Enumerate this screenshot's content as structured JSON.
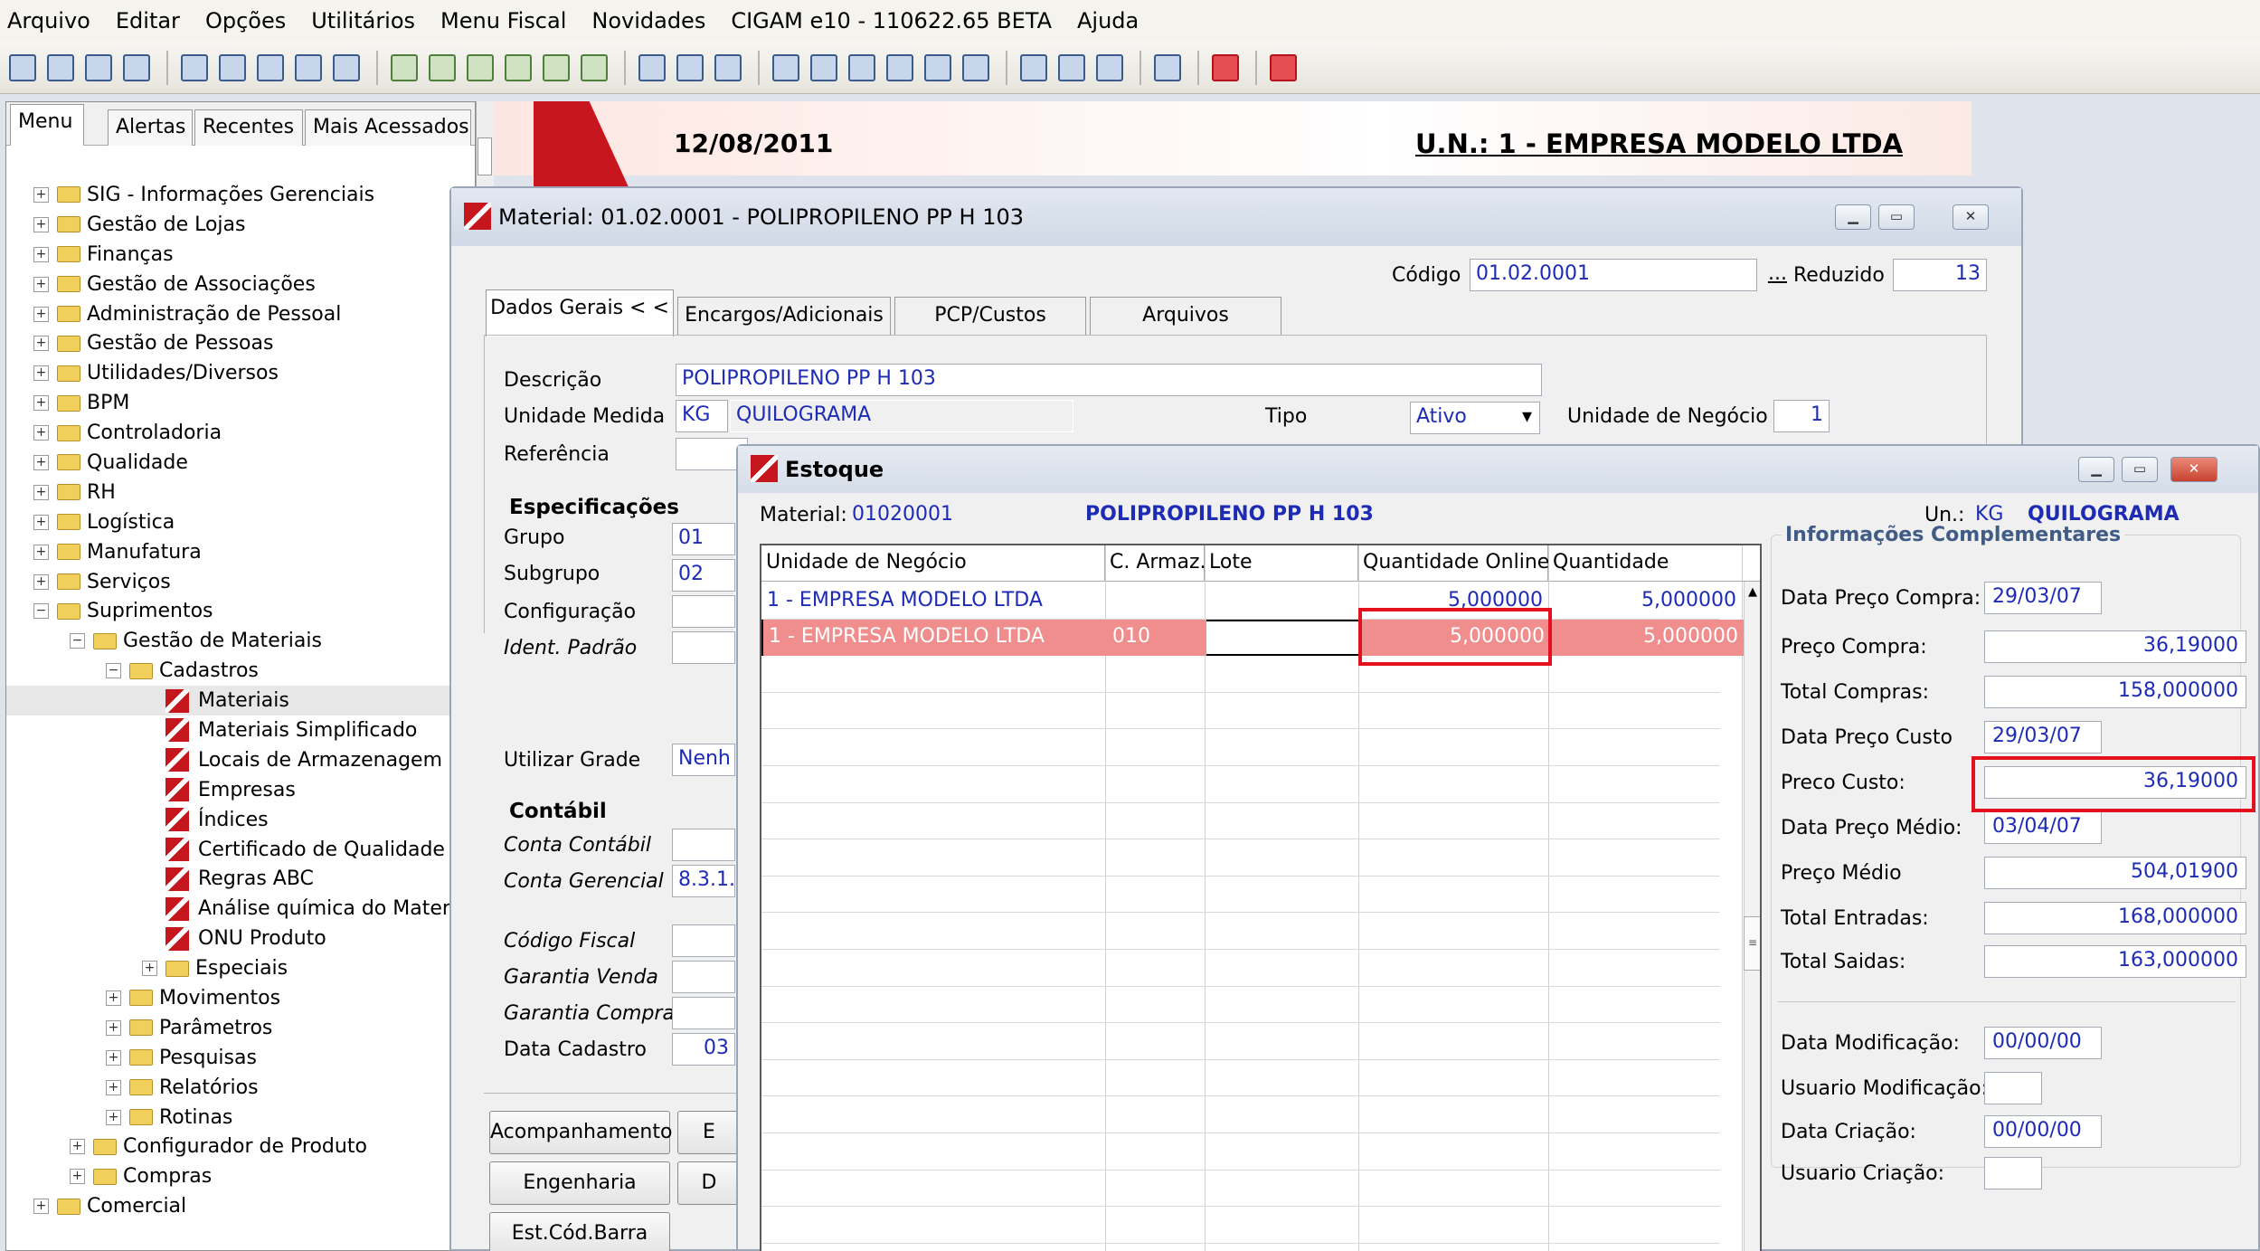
{
  "menubar": {
    "items": [
      "Arquivo",
      "Editar",
      "Opções",
      "Utilitários",
      "Menu Fiscal",
      "Novidades",
      "CIGAM e10 - 110622.65 BETA",
      "Ajuda"
    ]
  },
  "left_panel": {
    "tabs": [
      "Menu",
      "Alertas",
      "Recentes",
      "Mais Acessados"
    ],
    "tree": [
      {
        "label": "SIG - Informações Gerenciais",
        "level": 0,
        "expander": "+",
        "icon": "folder"
      },
      {
        "label": "Gestão de Lojas",
        "level": 0,
        "expander": "+",
        "icon": "folder"
      },
      {
        "label": "Finanças",
        "level": 0,
        "expander": "+",
        "icon": "folder"
      },
      {
        "label": "Gestão de Associações",
        "level": 0,
        "expander": "+",
        "icon": "folder"
      },
      {
        "label": "Administração de Pessoal",
        "level": 0,
        "expander": "+",
        "icon": "folder"
      },
      {
        "label": "Gestão de Pessoas",
        "level": 0,
        "expander": "+",
        "icon": "folder"
      },
      {
        "label": "Utilidades/Diversos",
        "level": 0,
        "expander": "+",
        "icon": "folder"
      },
      {
        "label": "BPM",
        "level": 0,
        "expander": "+",
        "icon": "folder"
      },
      {
        "label": "Controladoria",
        "level": 0,
        "expander": "+",
        "icon": "folder"
      },
      {
        "label": "Qualidade",
        "level": 0,
        "expander": "+",
        "icon": "folder"
      },
      {
        "label": "RH",
        "level": 0,
        "expander": "+",
        "icon": "folder"
      },
      {
        "label": "Logística",
        "level": 0,
        "expander": "+",
        "icon": "folder"
      },
      {
        "label": "Manufatura",
        "level": 0,
        "expander": "+",
        "icon": "folder"
      },
      {
        "label": "Serviços",
        "level": 0,
        "expander": "+",
        "icon": "folder"
      },
      {
        "label": "Suprimentos",
        "level": 0,
        "expander": "−",
        "icon": "folder"
      },
      {
        "label": "Gestão de Materiais",
        "level": 1,
        "expander": "−",
        "icon": "folder"
      },
      {
        "label": "Cadastros",
        "level": 2,
        "expander": "−",
        "icon": "folder"
      },
      {
        "label": "Materiais",
        "level": 3,
        "expander": "",
        "icon": "form",
        "selected": true
      },
      {
        "label": "Materiais Simplificado",
        "level": 3,
        "expander": "",
        "icon": "form"
      },
      {
        "label": "Locais de Armazenagem",
        "level": 3,
        "expander": "",
        "icon": "form"
      },
      {
        "label": "Empresas",
        "level": 3,
        "expander": "",
        "icon": "form"
      },
      {
        "label": "Índices",
        "level": 3,
        "expander": "",
        "icon": "form"
      },
      {
        "label": "Certificado de Qualidade",
        "level": 3,
        "expander": "",
        "icon": "form"
      },
      {
        "label": "Regras ABC",
        "level": 3,
        "expander": "",
        "icon": "form"
      },
      {
        "label": "Análise química do Materia",
        "level": 3,
        "expander": "",
        "icon": "form"
      },
      {
        "label": "ONU Produto",
        "level": 3,
        "expander": "",
        "icon": "form"
      },
      {
        "label": "Especiais",
        "level": 3,
        "expander": "+",
        "icon": "folder"
      },
      {
        "label": "Movimentos",
        "level": 2,
        "expander": "+",
        "icon": "folder"
      },
      {
        "label": "Parâmetros",
        "level": 2,
        "expander": "+",
        "icon": "folder"
      },
      {
        "label": "Pesquisas",
        "level": 2,
        "expander": "+",
        "icon": "folder"
      },
      {
        "label": "Relatórios",
        "level": 2,
        "expander": "+",
        "icon": "folder"
      },
      {
        "label": "Rotinas",
        "level": 2,
        "expander": "+",
        "icon": "folder"
      },
      {
        "label": "Configurador de Produto",
        "level": 1,
        "expander": "+",
        "icon": "folder"
      },
      {
        "label": "Compras",
        "level": 1,
        "expander": "+",
        "icon": "folder"
      },
      {
        "label": "Comercial",
        "level": 0,
        "expander": "+",
        "icon": "folder"
      }
    ]
  },
  "header": {
    "date": "12/08/2011",
    "un": "U.N.: 1 - EMPRESA MODELO LTDA"
  },
  "material_window": {
    "title": "Material: 01.02.0001 - POLIPROPILENO PP H 103",
    "codigo_label": "Código",
    "codigo": "01.02.0001",
    "ellipsis": "...",
    "reduzido_label": "Reduzido",
    "reduzido": "13",
    "tabs": [
      "Dados Gerais < <",
      "Encargos/Adicionais",
      "PCP/Custos",
      "Arquivos"
    ],
    "descricao_label": "Descrição",
    "descricao": "POLIPROPILENO PP H 103",
    "unidade_label": "Unidade Medida",
    "unidade": "KG",
    "unidade_nome": "QUILOGRAMA",
    "tipo_label": "Tipo",
    "tipo": "Ativo",
    "un_negocio_label": "Unidade de Negócio",
    "un_negocio": "1",
    "referencia_label": "Referência",
    "especificacoes": "Especificações",
    "grupo_label": "Grupo",
    "grupo": "01",
    "subgrupo_label": "Subgrupo",
    "subgrupo": "02",
    "configuracao_label": "Configuração",
    "ident_label": "Ident. Padrão",
    "grade_label": "Utilizar Grade",
    "grade": "Nenh",
    "contabil": "Contábil",
    "conta_contabil_label": "Conta Contábil",
    "conta_gerencial_label": "Conta Gerencial",
    "conta_gerencial": "8.3.1.",
    "codigo_fiscal_label": "Código Fiscal",
    "garantia_venda_label": "Garantia Venda",
    "garantia_compra_label": "Garantia Compra",
    "data_cadastro_label": "Data Cadastro",
    "data_cadastro": "03",
    "btn_acompanhamento": "Acompanhamento",
    "btn_e": "E",
    "btn_engenharia": "Engenharia",
    "btn_d": "D",
    "btn_estcod": "Est.Cód.Barra"
  },
  "estoque_window": {
    "title": "Estoque",
    "material_label": "Material:",
    "material_code": "01020001",
    "material_name": "POLIPROPILENO PP H 103",
    "un_label": "Un.:",
    "un": "KG",
    "un_nome": "QUILOGRAMA",
    "columns": [
      "Unidade de Negócio",
      "C. Armaz.",
      "Lote",
      "Quantidade Online",
      "Quantidade"
    ],
    "rows": [
      {
        "unidade": "1 - EMPRESA MODELO LTDA",
        "armaz": "",
        "lote": "",
        "qtd_online": "5,000000",
        "qtd": "5,000000",
        "selected": false
      },
      {
        "unidade": "1 - EMPRESA MODELO LTDA",
        "armaz": "010",
        "lote": "",
        "qtd_online": "5,000000",
        "qtd": "5,000000",
        "selected": true
      }
    ],
    "info_title": "Informações Complementares",
    "info": {
      "data_preco_compra_label": "Data Preço Compra:",
      "data_preco_compra": "29/03/07",
      "preco_compra_label": "Preço Compra:",
      "preco_compra": "36,19000",
      "total_compras_label": "Total Compras:",
      "total_compras": "158,000000",
      "data_preco_custo_label": "Data Preço Custo",
      "data_preco_custo": "29/03/07",
      "preco_custo_label": "Preco Custo:",
      "preco_custo": "36,19000",
      "data_preco_medio_label": "Data Preço Médio:",
      "data_preco_medio": "03/04/07",
      "preco_medio_label": "Preço Médio",
      "preco_medio": "504,01900",
      "total_entradas_label": "Total Entradas:",
      "total_entradas": "168,000000",
      "total_saidas_label": "Total Saidas:",
      "total_saidas": "163,000000",
      "data_modificacao_label": "Data Modificação:",
      "data_modificacao": "00/00/00",
      "usuario_modificacao_label": "Usuario Modificação:",
      "data_criacao_label": "Data Criação:",
      "data_criacao": "00/00/00",
      "usuario_criacao_label": "Usuario Criação:"
    }
  },
  "colors": {
    "accent": "#c4161c",
    "highlight": "#e3111d",
    "selected_row": "#f08d8d",
    "value_text": "#1d2bb5"
  }
}
